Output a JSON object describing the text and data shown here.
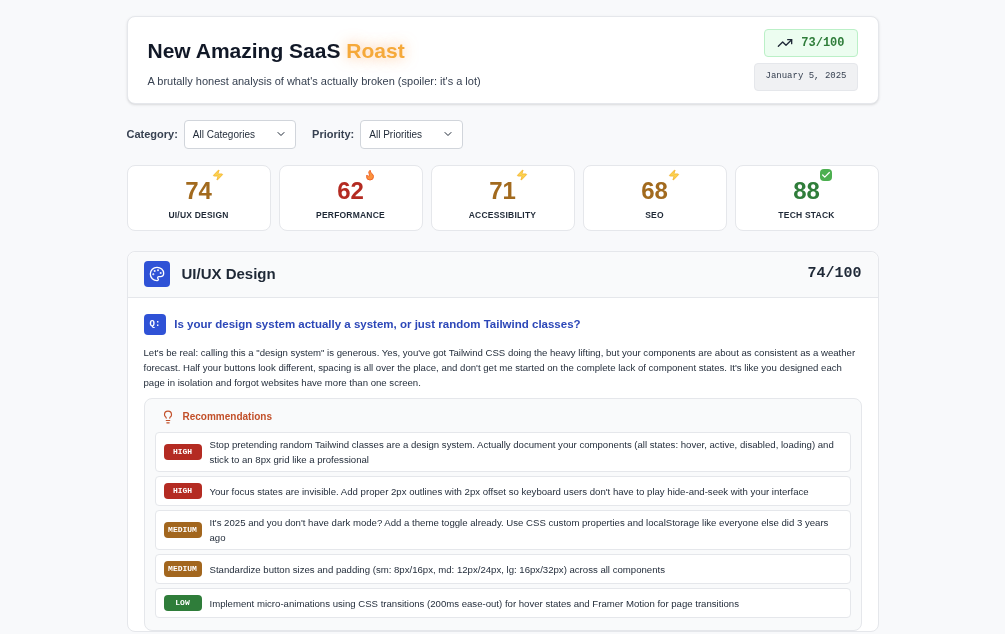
{
  "header": {
    "title": "New Amazing SaaS",
    "title_highlight": "Roast",
    "subtitle": "A brutally honest analysis of what's actually broken (spoiler: it's a lot)",
    "score": "73/100",
    "date": "January 5, 2025"
  },
  "filters": [
    {
      "label": "Category:",
      "value": "All Categories"
    },
    {
      "label": "Priority:",
      "value": "All Priorities"
    }
  ],
  "scores": [
    {
      "value": "74",
      "label": "UI/UX DESIGN",
      "kind": "warning"
    },
    {
      "value": "62",
      "label": "PERFORMANCE",
      "kind": "danger"
    },
    {
      "value": "71",
      "label": "ACCESSIBILITY",
      "kind": "warning"
    },
    {
      "value": "68",
      "label": "SEO",
      "kind": "warning"
    },
    {
      "value": "88",
      "label": "TECH STACK",
      "kind": "good"
    }
  ],
  "section": {
    "title": "UI/UX Design",
    "score": "74/100",
    "question_badge": "Q:",
    "question": "Is your design system actually a system, or just random Tailwind classes?",
    "answer": "Let's be real: calling this a \"design system\" is generous. Yes, you've got Tailwind CSS doing the heavy lifting, but your components are about as consistent as a weather forecast. Half your buttons look different, spacing is all over the place, and don't get me started on the complete lack of component states. It's like you designed each page in isolation and forgot websites have more than one screen.",
    "recommendations_title": "Recommendations",
    "recommendations": [
      {
        "priority": "HIGH",
        "kind": "high",
        "text": "Stop pretending random Tailwind classes are a design system. Actually document your components (all states: hover, active, disabled, loading) and stick to an 8px grid like a professional"
      },
      {
        "priority": "HIGH",
        "kind": "high",
        "text": "Your focus states are invisible. Add proper 2px outlines with 2px offset so keyboard users don't have to play hide-and-seek with your interface"
      },
      {
        "priority": "MEDIUM",
        "kind": "medium",
        "text": "It's 2025 and you don't have dark mode? Add a theme toggle already. Use CSS custom properties and localStorage like everyone else did 3 years ago"
      },
      {
        "priority": "MEDIUM",
        "kind": "medium",
        "text": "Standardize button sizes and padding (sm: 8px/16px, md: 12px/24px, lg: 16px/32px) across all components"
      },
      {
        "priority": "LOW",
        "kind": "low",
        "text": "Implement micro-animations using CSS transitions (200ms ease-out) for hover states and Framer Motion for page transitions"
      }
    ]
  }
}
